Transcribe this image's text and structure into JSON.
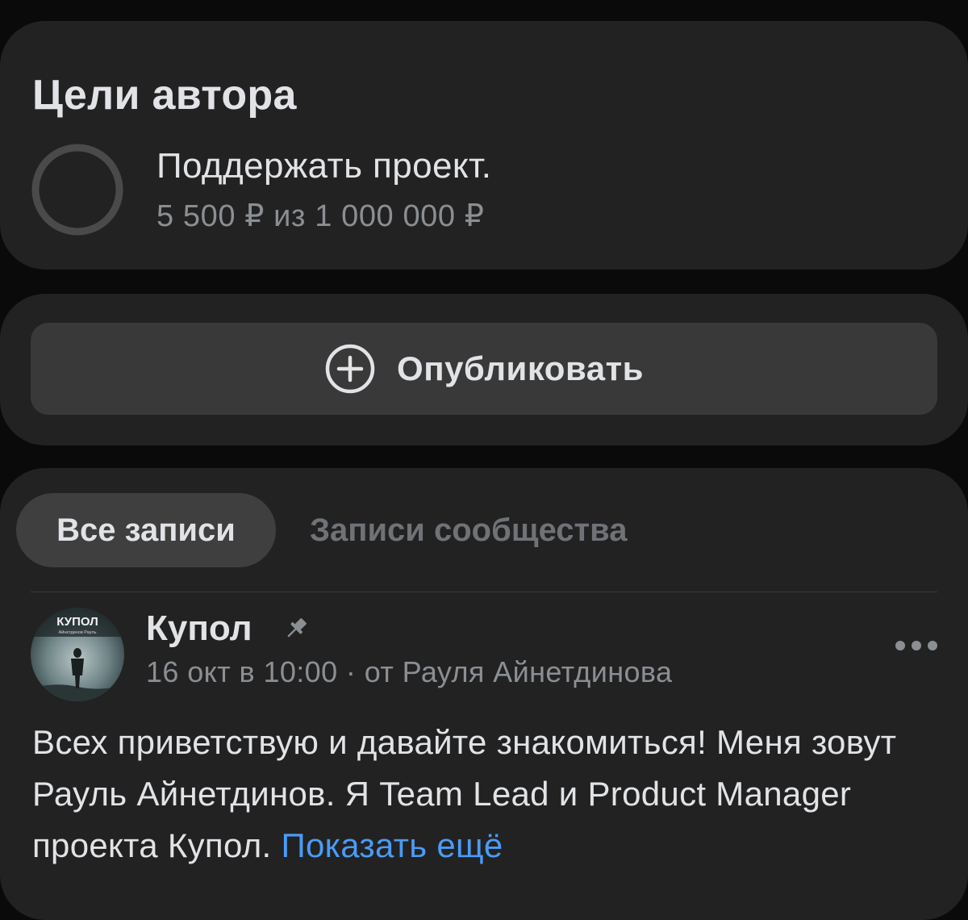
{
  "goals": {
    "title": "Цели автора",
    "goal": {
      "title": "Поддержать проект.",
      "progress_text": "5 500 ₽ из 1 000 000 ₽",
      "collected": 5500,
      "target": 1000000
    }
  },
  "publish": {
    "label": "Опубликовать",
    "icon": "plus-circle-icon"
  },
  "feed": {
    "tabs": [
      {
        "label": "Все записи",
        "active": true
      },
      {
        "label": "Записи сообщества",
        "active": false
      }
    ],
    "post": {
      "avatar_logo_text": "КУПОЛ",
      "avatar_logo_subtext": "Айнетдинов Рауль",
      "author": "Купол",
      "meta": "16 окт в 10:00 · от Рауля Айнетдинова",
      "text": "Всех приветствую и давайте знакомиться! Меня зовут Рауль Айнетдинов. Я Team Lead и Product Manager проекта Купол.",
      "show_more_label": "Показать ещё",
      "pinned": true
    }
  },
  "colors": {
    "background": "#0a0a0a",
    "card": "#222222",
    "button": "#393939",
    "text_primary": "#e1e3e6",
    "text_secondary": "#8b8f94",
    "link": "#4a9bf5"
  }
}
